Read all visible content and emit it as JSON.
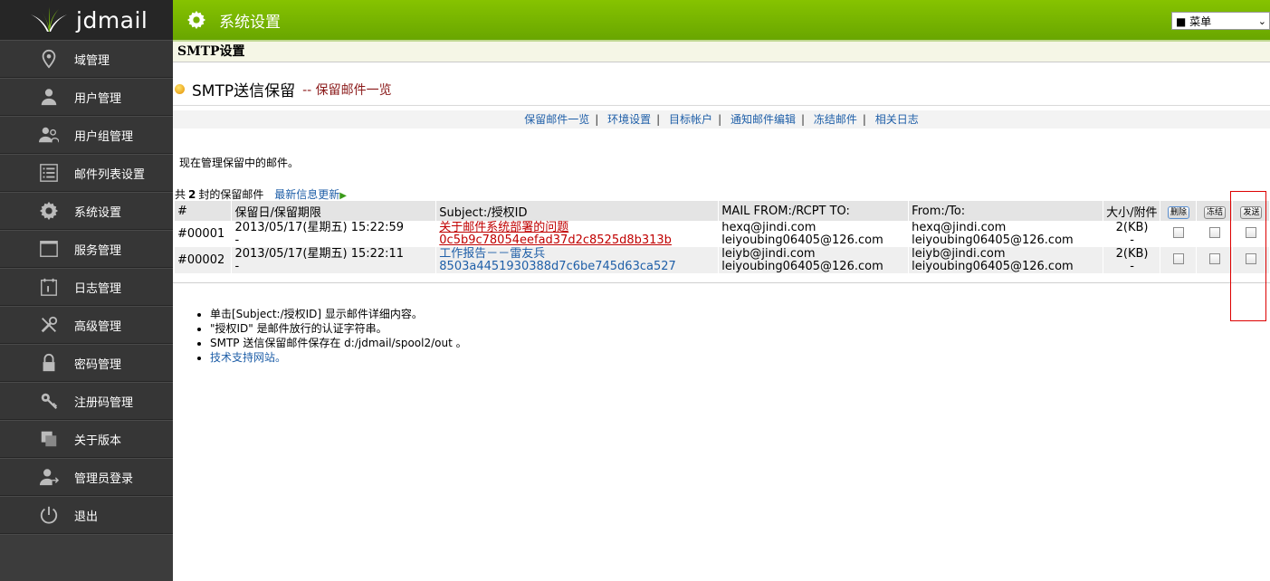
{
  "app": {
    "logo_text": "jdmail"
  },
  "header": {
    "title": "系统设置",
    "menu_select": "■ 菜单"
  },
  "sidebar": {
    "items": [
      {
        "label": "域管理",
        "icon": "map-pin-icon"
      },
      {
        "label": "用户管理",
        "icon": "user-icon"
      },
      {
        "label": "用户组管理",
        "icon": "users-icon"
      },
      {
        "label": "邮件列表设置",
        "icon": "list-icon"
      },
      {
        "label": "系统设置",
        "icon": "gear-icon"
      },
      {
        "label": "服务管理",
        "icon": "window-icon"
      },
      {
        "label": "日志管理",
        "icon": "calendar-icon"
      },
      {
        "label": "高级管理",
        "icon": "tools-icon"
      },
      {
        "label": "密码管理",
        "icon": "lock-icon"
      },
      {
        "label": "注册码管理",
        "icon": "key-icon"
      },
      {
        "label": "关于版本",
        "icon": "copy-icon"
      },
      {
        "label": "管理员登录",
        "icon": "admin-user-icon"
      },
      {
        "label": "退出",
        "icon": "power-icon"
      }
    ]
  },
  "main": {
    "section_title": "SMTP设置",
    "heading": "SMTP送信保留",
    "heading_sub": "-- 保留邮件一览",
    "subnav": [
      "保留邮件一览",
      "环境设置",
      "目标帐户",
      "通知邮件编辑",
      "冻结邮件",
      "相关日志"
    ],
    "description": "现在管理保留中的邮件。",
    "summary": {
      "prefix": "共",
      "count": "2",
      "suffix": "封的保留邮件",
      "refresh": "最新信息更新"
    },
    "table": {
      "headers": [
        "#",
        "保留日/保留期限",
        "Subject:/授权ID",
        "MAIL FROM:/RCPT TO:",
        "From:/To:",
        "大小/附件"
      ],
      "buttons": {
        "delete": "删除",
        "freeze": "冻结",
        "send": "发送"
      },
      "rows": [
        {
          "id": "#00001",
          "date": "2013/05/17(星期五) 15:22:59",
          "expire": "-",
          "subject": "关于邮件系统部署的问题",
          "auth_id": "0c5b9c78054eefad37d2c8525d8b313b",
          "mail_from": "hexq@jindi.com",
          "rcpt_to": "leiyoubing06405@126.com",
          "from": "hexq@jindi.com",
          "to": "leiyoubing06405@126.com",
          "size": "2(KB)",
          "attach": "-"
        },
        {
          "id": "#00002",
          "date": "2013/05/17(星期五) 15:22:11",
          "expire": "-",
          "subject": "工作报告－－雷友兵",
          "auth_id": "8503a4451930388d7c6be745d63ca527",
          "mail_from": "leiyb@jindi.com",
          "rcpt_to": "leiyoubing06405@126.com",
          "from": "leiyb@jindi.com",
          "to": "leiyoubing06405@126.com",
          "size": "2(KB)",
          "attach": "-"
        }
      ]
    },
    "notes": [
      "单击[Subject:/授权ID] 显示邮件详细内容。",
      "\"授权ID\" 是邮件放行的认证字符串。",
      "SMTP 送信保留邮件保存在 d:/jdmail/spool2/out 。",
      "技术支持网站。"
    ]
  },
  "colors": {
    "header_green": "#78b400",
    "sidebar_bg": "#363636",
    "link_blue": "#1f5fa8",
    "subject_red": "#c00000",
    "annotation_red": "#dd0000"
  }
}
